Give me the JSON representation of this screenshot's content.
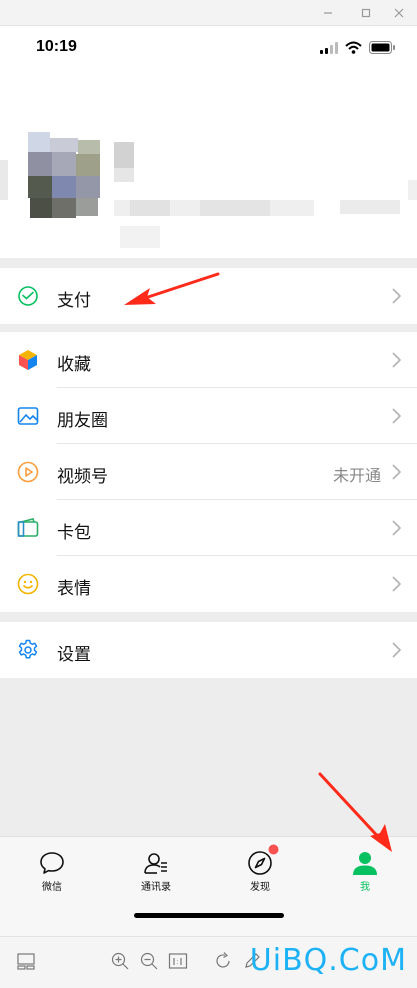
{
  "status_bar": {
    "time": "10:19"
  },
  "menu": {
    "pay": {
      "label": "支付"
    },
    "items": [
      {
        "label": "收藏",
        "value": ""
      },
      {
        "label": "朋友圈",
        "value": ""
      },
      {
        "label": "视频号",
        "value": "未开通"
      },
      {
        "label": "卡包",
        "value": ""
      },
      {
        "label": "表情",
        "value": ""
      }
    ],
    "settings": {
      "label": "设置"
    }
  },
  "tabbar": {
    "tabs": [
      {
        "label": "微信",
        "active": false
      },
      {
        "label": "通讯录",
        "active": false
      },
      {
        "label": "发现",
        "active": false,
        "badge": true
      },
      {
        "label": "我",
        "active": true
      }
    ]
  },
  "watermark": "UiBQ.CoM",
  "colors": {
    "accent": "#07c160",
    "badge": "#fa5151",
    "arrow": "#ff2a1a",
    "watermark": "#1db2f5"
  }
}
